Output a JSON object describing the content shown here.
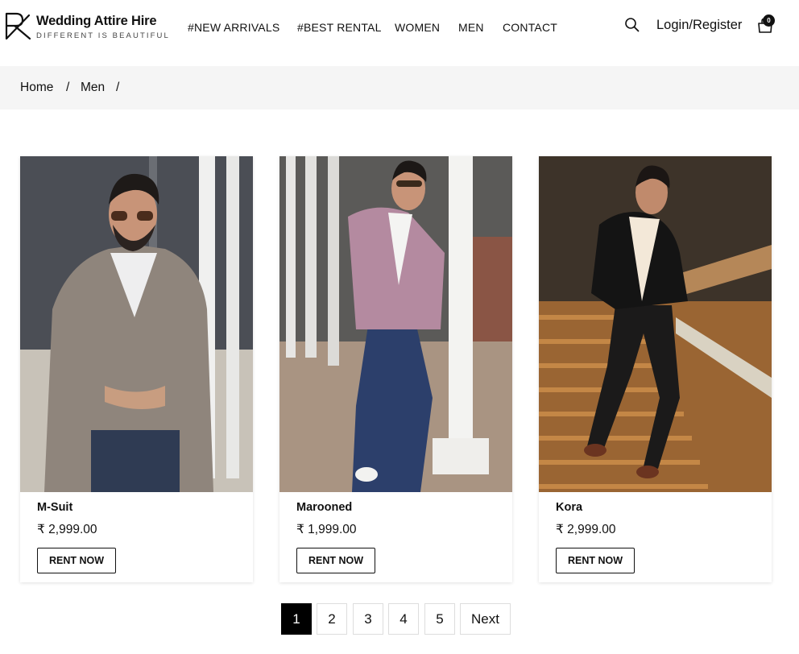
{
  "brand": {
    "name": "Wedding Attire Hire",
    "tagline": "DIFFERENT IS BEAUTIFUL"
  },
  "nav": {
    "items": [
      {
        "label": "#NEW ARRIVALS"
      },
      {
        "label": "#BEST RENTAL"
      },
      {
        "label": "WOMEN"
      },
      {
        "label": "MEN"
      },
      {
        "label": "CONTACT"
      }
    ]
  },
  "header": {
    "search_icon": "search-icon",
    "login_label": "Login/Register",
    "cart_icon": "shopping-bag-icon",
    "cart_count": "0"
  },
  "breadcrumb": {
    "items": [
      "Home",
      "Men"
    ],
    "separator": "/"
  },
  "products": [
    {
      "name": "M-Suit",
      "price": "₹ 2,999.00",
      "cta": "RENT NOW"
    },
    {
      "name": "Marooned",
      "price": "₹ 1,999.00",
      "cta": "RENT NOW"
    },
    {
      "name": "Kora",
      "price": "₹ 2,999.00",
      "cta": "RENT NOW"
    }
  ],
  "pagination": {
    "pages": [
      "1",
      "2",
      "3",
      "4",
      "5"
    ],
    "current": "1",
    "next_label": "Next"
  },
  "colors": {
    "accent": "#000000",
    "breadcrumb_bg": "#f5f5f5",
    "text": "#111111"
  }
}
